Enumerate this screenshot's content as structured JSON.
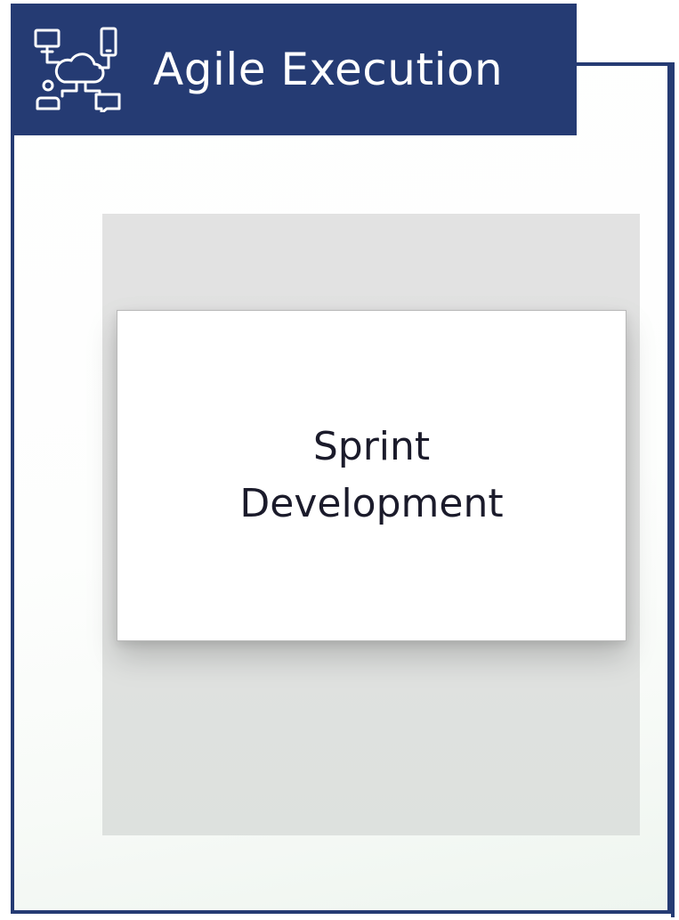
{
  "header": {
    "title": "Agile Execution",
    "icon": "cloud-network-devices-icon",
    "color": "#253b73"
  },
  "card": {
    "text": "Sprint\nDevelopment"
  },
  "colors": {
    "primary": "#253b73",
    "card_background": "#ffffff",
    "column_background": "#e2e2e2",
    "text": "#1b1b2b"
  }
}
